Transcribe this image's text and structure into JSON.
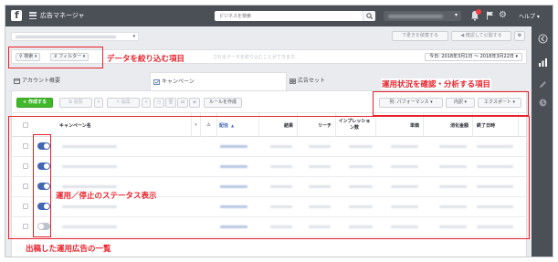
{
  "topbar": {
    "logo": "f",
    "app_title": "広告マネージャ",
    "search_placeholder": "ビジネスを検索",
    "help_label": "ヘルプ"
  },
  "header": {
    "discard_label": "下書きを破棄する",
    "review_label": "確認して公開する"
  },
  "filter_bar": {
    "search_label": "検索",
    "filter_label": "フィルター",
    "hint": "されるデータを絞り込むことができます。",
    "date_range": "今日: 2018年3月1日 ～ 2018年3月22日"
  },
  "tabs": [
    {
      "label": "アカウント概要"
    },
    {
      "label": "キャンペーン"
    },
    {
      "label": "広告セット"
    }
  ],
  "toolbar": {
    "create_label": "+ 作成する",
    "duplicate_label": "複製",
    "edit_label": "編集",
    "rule_label": "ルールを作成",
    "columns_label": "列: パフォーマンス",
    "breakdown_label": "内訳",
    "export_label": "エクスポート"
  },
  "table": {
    "columns": [
      "キャンペーン名",
      "配信",
      "結果",
      "リーチ",
      "インプレッション数",
      "単価",
      "消化金額",
      "終了日時"
    ],
    "rows": [
      {
        "status": "on"
      },
      {
        "status": "on"
      },
      {
        "status": "on"
      },
      {
        "status": "on"
      },
      {
        "status": "off"
      }
    ]
  },
  "annotations": {
    "filter": "データを絞り込む項目",
    "analysis": "運用状況を確認・分析する項目",
    "status": "運用／停止のステータス表示",
    "list": "出稿した運用広告の一覧"
  },
  "colors": {
    "annotation": "#e8212b",
    "topbar": "#4b4f56",
    "toggle_on": "#4267b2",
    "create_button": "#42b72a"
  },
  "icons": [
    "facebook-logo-icon",
    "hamburger-icon",
    "search-icon",
    "notifications-icon",
    "flag-icon",
    "gear-icon",
    "campaign-icon",
    "adset-icon",
    "account-icon"
  ]
}
